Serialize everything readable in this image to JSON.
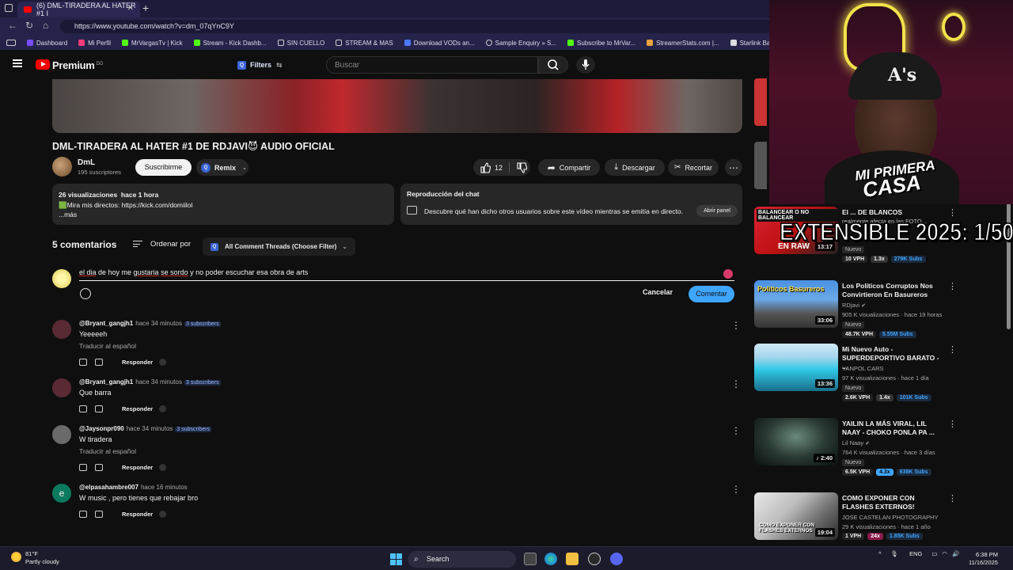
{
  "browser": {
    "tab_title": "(6) DML-TIRADERA AL HATER #1 I",
    "url": "https://www.youtube.com/watch?v=dm_07qYnC9Y",
    "bookmarks": [
      "Dashboard",
      "Mi Perfil",
      "MrVargasTv | Kick",
      "Stream - Kick Dashb...",
      "SIN CUELLO",
      "STREAM & MAS",
      "Download VODs an...",
      "Sample Enquiry » S...",
      "Subscribe to MrVar...",
      "StreamerStats.com |...",
      "Starlink Battery Pow..."
    ]
  },
  "header": {
    "logo_text": "Premium",
    "logo_sup": "DO",
    "filters_label": "Filters",
    "search_placeholder": "Buscar"
  },
  "video": {
    "title": "DML-TIRADERA AL HATER #1 DE RDJAVI😈 AUDIO OFICIAL",
    "channel": "DmL",
    "subscribers": "195 suscriptores",
    "subscribe_label": "Suscribirme",
    "remix_label": "Remix",
    "likes": "12",
    "share_label": "Compartir",
    "download_label": "Descargar",
    "clip_label": "Recortar"
  },
  "description": {
    "views": "26 visualizaciones",
    "time": "hace 1 hora",
    "line2": "🟩Mira mis directos: https://kick.com/domiilol",
    "more": "...más"
  },
  "chat_replay": {
    "title": "Reproducción del chat",
    "desc": "Descubre qué han dicho otros usuarios sobre este vídeo mientras se emitía en directo.",
    "open_label": "Abrir panel"
  },
  "comments_header": {
    "count": "5 comentarios",
    "sort_label": "Ordenar por",
    "filter_label": "All Comment Threads (Choose Filter)"
  },
  "composer": {
    "w1": "el dia",
    "w2": " de hoy me ",
    "w3": "gustaria",
    "w4": " ",
    "w5": "se sordo",
    "w6": " y no poder escuchar esa obra de arts",
    "cancel_label": "Cancelar",
    "submit_label": "Comentar"
  },
  "comments": [
    {
      "author": "@Bryant_gangjh1",
      "time": "hace 34 minutos",
      "subs": "3 subscribers",
      "text": "Yeeeeeh",
      "translate": "Traducir al español",
      "reply": "Responder",
      "avatar_color": "#5a2a34"
    },
    {
      "author": "@Bryant_gangjh1",
      "time": "hace 34 minutos",
      "subs": "3 subscribers",
      "text": "Que barra",
      "translate": "",
      "reply": "Responder",
      "avatar_color": "#5a2a34"
    },
    {
      "author": "@Jaysonpr090",
      "time": "hace 34 minutos",
      "subs": "3 subscribers",
      "text": "W tiradera",
      "translate": "Traducir al español",
      "reply": "Responder",
      "avatar_color": "#6a6a6a"
    },
    {
      "author": "@elpasahambre007",
      "time": "hace 16 minutos",
      "subs": "",
      "text": "W music , pero tienes que rebajar bro",
      "translate": "",
      "reply": "Responder",
      "avatar_color": "#0b7a5e",
      "avatar_letter": "e"
    }
  ],
  "recommendations": [
    {
      "title": "El ... DE BLANCOS",
      "subtitle": "realmente afecta en las FOTO...",
      "thumb_text": "BALANCEAR O NO BALANCEAR",
      "thumb_text2": "EN RAW",
      "duration": "13:17",
      "channel": "",
      "meta": "",
      "nuevo": "Nuevo",
      "vph": "10 VPH",
      "mult": "1.3x",
      "subs": "279K Subs"
    },
    {
      "title": "Los Políticos Corruptos Nos Convirtieron En Basureros",
      "thumb_text": "Politicos Basureros",
      "duration": "33:06",
      "channel": "RDjavi",
      "meta": "905 K visualizaciones · hace 19 horas",
      "nuevo": "Nuevo",
      "vph": "48.7K VPH",
      "mult": "",
      "subs": "5.55M Subs"
    },
    {
      "title": "Mi Nuevo Auto - SUPERDEPORTIVO BARATO - ...",
      "duration": "13:36",
      "channel": "YANPOL CARS",
      "meta": "97 K visualizaciones · hace 1 día",
      "nuevo": "Nuevo",
      "vph": "2.6K VPH",
      "mult": "1.4x",
      "subs": "101K Subs"
    },
    {
      "title": "YAILIN LA MÁS VIRAL, LIL NAAY - CHOKO PONLA PA ...",
      "duration": "2:40",
      "channel": "Lil Naay",
      "meta": "764 K visualizaciones · hace 3 días",
      "nuevo": "Nuevo",
      "vph": "6.5K VPH",
      "mult": "4.3x",
      "subs": "638K Subs"
    },
    {
      "title": "COMO EXPONER CON FLASHES EXTERNOS!",
      "thumb_text": "COMO EXPONER CON FLASHES EXTERNOS",
      "duration": "19:04",
      "channel": "JOSE CASTELAN PHOTOGRAPHY",
      "meta": "29 K visualizaciones · hace 1 año",
      "nuevo": "",
      "vph": "1 VPH",
      "mult": "24x",
      "subs": "1.85K Subs"
    }
  ],
  "overlay": {
    "casa_line1": "MI PRIMERA",
    "casa_line2": "CASA",
    "cap_letter": "A's",
    "banner": "EXTENSIBLE 2025: 1/50"
  },
  "taskbar": {
    "temp": "81°F",
    "weather": "Partly cloudy",
    "search_label": "Search",
    "lang": "ENG",
    "time": "6:38 PM",
    "date": "11/16/2025"
  },
  "colors": {
    "accent_blue": "#3ea6ff",
    "youtube_red": "#ff0000",
    "neon_yellow": "#f2e24a"
  }
}
